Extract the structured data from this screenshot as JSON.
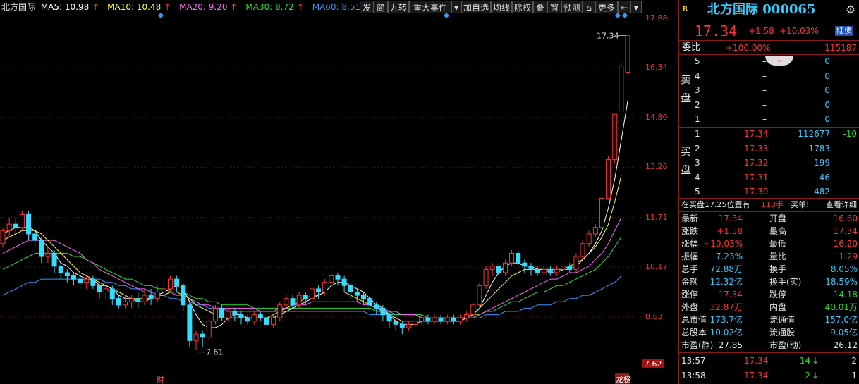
{
  "ma_legend": {
    "stock": "北方国际",
    "ma5": "MA5: 10.98",
    "ma10": "MA10: 10.48",
    "ma20": "MA20: 9.20",
    "ma30": "MA30: 8.72",
    "ma60": "MA60: 8.51",
    "up_arrow": "↑",
    "colors": {
      "ma5": "#ffffff",
      "ma10": "#ffff33",
      "ma20": "#ff66ff",
      "ma30": "#33dd33",
      "ma60": "#3399ff"
    }
  },
  "toolbar": [
    "发",
    "简",
    "九转",
    "重大事件",
    "加自选",
    "均线",
    "除权",
    "叠",
    "窗",
    "预测",
    "更多"
  ],
  "toolbar_icons": [
    "dropdown-icon",
    "lock-icon",
    "back-icon",
    "menu-arrow-icon"
  ],
  "y_axis": {
    "labels": [
      "17.88",
      "16.34",
      "14.80",
      "13.26",
      "11.71",
      "10.17",
      "8.63",
      "7.62"
    ],
    "values": [
      17.88,
      16.34,
      14.8,
      13.26,
      11.71,
      10.17,
      8.63,
      7.62
    ]
  },
  "annotations": {
    "high_label": "17.34",
    "low_label": "7.61",
    "event_cai": "财",
    "event_long": "龙榜"
  },
  "chart_data": {
    "type": "candlestick",
    "ymin": 7.1,
    "ymax": 18.0,
    "candles": [
      [
        10.9,
        11.3,
        10.8,
        11.4
      ],
      [
        11.3,
        11.5,
        11.1,
        11.7
      ],
      [
        11.5,
        11.4,
        11.2,
        11.7
      ],
      [
        11.4,
        11.8,
        11.3,
        11.9
      ],
      [
        11.8,
        11.2,
        11.0,
        11.9
      ],
      [
        11.2,
        11.0,
        10.8,
        11.4
      ],
      [
        11.0,
        10.5,
        10.3,
        11.1
      ],
      [
        10.5,
        10.6,
        10.3,
        10.8
      ],
      [
        10.6,
        10.2,
        10.0,
        10.7
      ],
      [
        10.2,
        10.0,
        9.8,
        10.3
      ],
      [
        10.0,
        9.9,
        9.7,
        10.1
      ],
      [
        9.9,
        9.8,
        9.6,
        10.0
      ],
      [
        9.8,
        9.7,
        9.5,
        9.9
      ],
      [
        9.7,
        9.8,
        9.5,
        9.9
      ],
      [
        9.8,
        9.6,
        9.5,
        9.9
      ],
      [
        9.6,
        9.4,
        9.2,
        9.7
      ],
      [
        9.4,
        9.5,
        9.2,
        9.6
      ],
      [
        9.5,
        9.2,
        9.0,
        9.6
      ],
      [
        9.2,
        9.0,
        8.9,
        9.3
      ],
      [
        9.0,
        9.1,
        8.9,
        9.3
      ],
      [
        9.1,
        9.2,
        8.9,
        9.3
      ],
      [
        9.2,
        9.1,
        8.9,
        9.4
      ],
      [
        9.1,
        9.3,
        9.0,
        9.5
      ],
      [
        9.3,
        9.2,
        9.0,
        9.5
      ],
      [
        9.2,
        9.4,
        9.1,
        9.6
      ],
      [
        9.4,
        9.5,
        9.2,
        9.7
      ],
      [
        9.5,
        9.8,
        9.4,
        9.9
      ],
      [
        9.8,
        9.6,
        9.4,
        9.9
      ],
      [
        9.6,
        9.0,
        8.8,
        9.7
      ],
      [
        9.0,
        7.9,
        7.7,
        9.1
      ],
      [
        7.9,
        8.1,
        7.6,
        8.2
      ],
      [
        8.1,
        8.0,
        7.7,
        8.2
      ],
      [
        8.0,
        8.5,
        7.9,
        8.6
      ],
      [
        8.5,
        8.9,
        8.4,
        9.0
      ],
      [
        8.9,
        8.6,
        8.5,
        9.0
      ],
      [
        8.6,
        8.8,
        8.5,
        8.9
      ],
      [
        8.8,
        8.7,
        8.5,
        8.9
      ],
      [
        8.7,
        8.6,
        8.4,
        8.8
      ],
      [
        8.6,
        8.5,
        8.4,
        8.7
      ],
      [
        8.5,
        8.7,
        8.4,
        8.8
      ],
      [
        8.7,
        8.6,
        8.5,
        8.8
      ],
      [
        8.6,
        8.4,
        8.3,
        8.7
      ],
      [
        8.4,
        8.6,
        8.3,
        8.7
      ],
      [
        8.6,
        9.0,
        8.5,
        9.1
      ],
      [
        9.0,
        9.2,
        8.9,
        9.3
      ],
      [
        9.2,
        9.0,
        8.9,
        9.3
      ],
      [
        9.0,
        9.3,
        8.9,
        9.4
      ],
      [
        9.3,
        9.2,
        9.0,
        9.4
      ],
      [
        9.2,
        9.5,
        9.1,
        9.6
      ],
      [
        9.5,
        9.4,
        9.2,
        9.6
      ],
      [
        9.4,
        9.7,
        9.3,
        9.8
      ],
      [
        9.7,
        9.9,
        9.6,
        10.0
      ],
      [
        9.9,
        9.8,
        9.6,
        10.0
      ],
      [
        9.8,
        9.6,
        9.4,
        9.9
      ],
      [
        9.6,
        9.4,
        9.2,
        9.7
      ],
      [
        9.4,
        9.3,
        9.1,
        9.5
      ],
      [
        9.3,
        9.2,
        9.0,
        9.4
      ],
      [
        9.2,
        9.0,
        8.9,
        9.3
      ],
      [
        9.0,
        8.9,
        8.7,
        9.1
      ],
      [
        8.9,
        8.7,
        8.5,
        9.0
      ],
      [
        8.7,
        8.5,
        8.3,
        8.8
      ],
      [
        8.5,
        8.4,
        8.2,
        8.6
      ],
      [
        8.4,
        8.3,
        8.1,
        8.5
      ],
      [
        8.3,
        8.4,
        8.2,
        8.5
      ],
      [
        8.4,
        8.5,
        8.3,
        8.6
      ],
      [
        8.5,
        8.6,
        8.4,
        8.7
      ],
      [
        8.6,
        8.5,
        8.4,
        8.7
      ],
      [
        8.5,
        8.6,
        8.4,
        8.7
      ],
      [
        8.6,
        8.5,
        8.4,
        8.7
      ],
      [
        8.5,
        8.6,
        8.4,
        8.7
      ],
      [
        8.6,
        8.5,
        8.4,
        8.7
      ],
      [
        8.5,
        8.6,
        8.4,
        8.7
      ],
      [
        8.6,
        8.7,
        8.5,
        8.8
      ],
      [
        8.7,
        9.0,
        8.6,
        9.1
      ],
      [
        9.0,
        9.6,
        8.9,
        9.7
      ],
      [
        9.6,
        10.1,
        9.5,
        10.2
      ],
      [
        10.1,
        10.2,
        9.9,
        10.3
      ],
      [
        10.2,
        10.0,
        9.9,
        10.3
      ],
      [
        10.0,
        10.3,
        9.9,
        10.4
      ],
      [
        10.3,
        10.6,
        10.2,
        10.7
      ],
      [
        10.6,
        10.3,
        10.2,
        10.7
      ],
      [
        10.3,
        10.2,
        10.0,
        10.4
      ],
      [
        10.2,
        10.1,
        9.9,
        10.3
      ],
      [
        10.1,
        10.0,
        9.9,
        10.2
      ],
      [
        10.0,
        10.1,
        9.9,
        10.2
      ],
      [
        10.1,
        10.0,
        9.9,
        10.2
      ],
      [
        10.0,
        10.1,
        9.9,
        10.2
      ],
      [
        10.1,
        10.2,
        10.0,
        10.3
      ],
      [
        10.2,
        10.1,
        10.0,
        10.3
      ],
      [
        10.1,
        10.5,
        10.0,
        10.6
      ],
      [
        10.5,
        10.9,
        10.4,
        11.0
      ],
      [
        10.9,
        11.2,
        10.8,
        11.3
      ],
      [
        11.2,
        11.4,
        11.1,
        11.5
      ],
      [
        11.4,
        12.3,
        11.3,
        12.4
      ],
      [
        12.3,
        13.5,
        12.9,
        13.6
      ],
      [
        13.5,
        14.9,
        13.4,
        14.9
      ],
      [
        15.0,
        16.4,
        15.0,
        16.5
      ],
      [
        16.2,
        17.34,
        16.2,
        17.34
      ]
    ],
    "ma5": [
      11.2,
      11.3,
      11.4,
      11.4,
      11.4,
      11.3,
      11.0,
      10.8,
      10.6,
      10.3,
      10.2,
      10.0,
      9.9,
      9.8,
      9.8,
      9.6,
      9.6,
      9.5,
      9.3,
      9.2,
      9.2,
      9.1,
      9.1,
      9.2,
      9.3,
      9.4,
      9.5,
      9.6,
      9.5,
      9.1,
      8.7,
      8.4,
      8.3,
      8.3,
      8.4,
      8.6,
      8.7,
      8.7,
      8.6,
      8.6,
      8.6,
      8.6,
      8.6,
      8.7,
      8.8,
      8.9,
      9.0,
      9.1,
      9.2,
      9.3,
      9.4,
      9.6,
      9.7,
      9.7,
      9.6,
      9.5,
      9.4,
      9.2,
      9.0,
      8.9,
      8.7,
      8.5,
      8.4,
      8.4,
      8.4,
      8.5,
      8.5,
      8.5,
      8.5,
      8.5,
      8.5,
      8.5,
      8.6,
      8.7,
      8.9,
      9.3,
      9.7,
      10.0,
      10.2,
      10.3,
      10.3,
      10.2,
      10.2,
      10.1,
      10.1,
      10.0,
      10.0,
      10.1,
      10.1,
      10.2,
      10.4,
      10.6,
      10.9,
      11.3,
      12.0,
      12.9,
      14.1,
      15.3
    ],
    "ma10": [
      11.0,
      11.1,
      11.2,
      11.3,
      11.3,
      11.3,
      11.2,
      11.0,
      10.8,
      10.6,
      10.4,
      10.2,
      10.0,
      9.9,
      9.8,
      9.7,
      9.6,
      9.5,
      9.4,
      9.3,
      9.2,
      9.2,
      9.2,
      9.2,
      9.3,
      9.3,
      9.4,
      9.4,
      9.3,
      9.2,
      9.0,
      8.9,
      8.8,
      8.7,
      8.6,
      8.6,
      8.6,
      8.6,
      8.6,
      8.6,
      8.6,
      8.6,
      8.7,
      8.8,
      8.9,
      9.0,
      9.1,
      9.2,
      9.3,
      9.3,
      9.4,
      9.4,
      9.4,
      9.4,
      9.3,
      9.2,
      9.1,
      9.0,
      8.9,
      8.8,
      8.7,
      8.6,
      8.5,
      8.5,
      8.5,
      8.5,
      8.5,
      8.5,
      8.5,
      8.5,
      8.5,
      8.5,
      8.6,
      8.7,
      8.9,
      9.1,
      9.3,
      9.5,
      9.7,
      9.9,
      10.0,
      10.1,
      10.1,
      10.1,
      10.1,
      10.1,
      10.1,
      10.1,
      10.2,
      10.3,
      10.4,
      10.6,
      10.8,
      11.1,
      11.5,
      12.2,
      13.0
    ],
    "ma20": [
      10.6,
      10.7,
      10.8,
      10.9,
      11.0,
      11.0,
      11.0,
      11.0,
      11.0,
      10.9,
      10.8,
      10.7,
      10.6,
      10.4,
      10.3,
      10.1,
      10.0,
      9.9,
      9.8,
      9.7,
      9.6,
      9.5,
      9.5,
      9.4,
      9.4,
      9.4,
      9.4,
      9.3,
      9.3,
      9.2,
      9.1,
      9.0,
      9.0,
      8.9,
      8.9,
      8.9,
      8.9,
      8.9,
      8.9,
      8.9,
      8.8,
      8.8,
      8.8,
      8.9,
      8.9,
      9.0,
      9.0,
      9.0,
      9.1,
      9.1,
      9.1,
      9.1,
      9.1,
      9.1,
      9.1,
      9.1,
      9.0,
      9.0,
      8.9,
      8.9,
      8.8,
      8.8,
      8.7,
      8.7,
      8.7,
      8.6,
      8.6,
      8.6,
      8.6,
      8.6,
      8.6,
      8.6,
      8.6,
      8.6,
      8.7,
      8.8,
      8.9,
      9.0,
      9.1,
      9.2,
      9.3,
      9.4,
      9.5,
      9.6,
      9.7,
      9.8,
      9.8,
      9.9,
      10.0,
      10.0,
      10.1,
      10.2,
      10.4,
      10.6,
      10.9,
      11.3,
      11.7
    ],
    "ma30": [
      10.1,
      10.2,
      10.3,
      10.4,
      10.5,
      10.6,
      10.6,
      10.6,
      10.6,
      10.6,
      10.6,
      10.5,
      10.5,
      10.4,
      10.3,
      10.2,
      10.1,
      10.0,
      9.9,
      9.8,
      9.8,
      9.7,
      9.6,
      9.6,
      9.5,
      9.5,
      9.4,
      9.4,
      9.4,
      9.3,
      9.2,
      9.2,
      9.1,
      9.1,
      9.0,
      9.0,
      9.0,
      9.0,
      9.0,
      8.9,
      8.9,
      8.9,
      8.9,
      8.9,
      8.9,
      8.9,
      8.9,
      8.9,
      8.9,
      8.9,
      8.9,
      8.9,
      8.9,
      8.9,
      8.9,
      8.9,
      8.9,
      8.9,
      8.8,
      8.8,
      8.8,
      8.7,
      8.7,
      8.7,
      8.7,
      8.7,
      8.6,
      8.6,
      8.6,
      8.6,
      8.6,
      8.6,
      8.6,
      8.7,
      8.7,
      8.8,
      8.8,
      8.9,
      9.0,
      9.1,
      9.1,
      9.2,
      9.3,
      9.4,
      9.4,
      9.5,
      9.6,
      9.6,
      9.7,
      9.8,
      9.9,
      10.0,
      10.1,
      10.3,
      10.5,
      10.8,
      11.1
    ],
    "ma60": [
      9.3,
      9.4,
      9.5,
      9.6,
      9.7,
      9.7,
      9.8,
      9.8,
      9.8,
      9.8,
      9.8,
      9.8,
      9.8,
      9.8,
      9.8,
      9.8,
      9.7,
      9.7,
      9.6,
      9.6,
      9.5,
      9.5,
      9.4,
      9.4,
      9.3,
      9.3,
      9.2,
      9.2,
      9.1,
      9.1,
      9.0,
      9.0,
      8.9,
      8.9,
      8.9,
      8.8,
      8.8,
      8.8,
      8.8,
      8.8,
      8.8,
      8.8,
      8.8,
      8.8,
      8.8,
      8.8,
      8.8,
      8.8,
      8.8,
      8.8,
      8.8,
      8.8,
      8.8,
      8.8,
      8.8,
      8.8,
      8.8,
      8.7,
      8.7,
      8.7,
      8.7,
      8.7,
      8.7,
      8.7,
      8.7,
      8.6,
      8.6,
      8.6,
      8.6,
      8.6,
      8.6,
      8.6,
      8.6,
      8.6,
      8.6,
      8.7,
      8.7,
      8.7,
      8.8,
      8.8,
      8.8,
      8.9,
      8.9,
      9.0,
      9.0,
      9.0,
      9.1,
      9.1,
      9.2,
      9.2,
      9.3,
      9.3,
      9.4,
      9.5,
      9.6,
      9.7,
      9.9
    ]
  },
  "panel": {
    "r_badge": "R",
    "stock_title": "北方国际 000065",
    "price": "17.34",
    "change": "+1.58",
    "change_pct": "+10.03%",
    "lugu_badge": "陆债",
    "weibi_label": "委比",
    "weibi_value": "+100.00%",
    "weibi_diff": "115187",
    "sell_label": "卖盘",
    "buy_label": "买盘",
    "sell": [
      {
        "level": "5",
        "price": "–",
        "vol": "0"
      },
      {
        "level": "4",
        "price": "–",
        "vol": "0"
      },
      {
        "level": "3",
        "price": "–",
        "vol": "0"
      },
      {
        "level": "2",
        "price": "–",
        "vol": "0"
      },
      {
        "level": "1",
        "price": "–",
        "vol": "0"
      }
    ],
    "buy": [
      {
        "level": "1",
        "price": "17.34",
        "vol": "112677",
        "extra": "-10"
      },
      {
        "level": "2",
        "price": "17.33",
        "vol": "1783",
        "extra": ""
      },
      {
        "level": "3",
        "price": "17.32",
        "vol": "199",
        "extra": ""
      },
      {
        "level": "4",
        "price": "17.31",
        "vol": "46",
        "extra": ""
      },
      {
        "level": "5",
        "price": "17.30",
        "vol": "482",
        "extra": ""
      }
    ],
    "notice": "在买盘17.25位置有",
    "notice_qty": "113手",
    "notice_type": "买单!",
    "notice_detail": "查看详细",
    "stats": [
      [
        "最新",
        "17.34",
        "开盘",
        "16.60"
      ],
      [
        "涨跌",
        "+1.58",
        "最高",
        "17.34"
      ],
      [
        "涨幅",
        "+10.03%",
        "最低",
        "16.20"
      ],
      [
        "振幅",
        "7.23%",
        "量比",
        "1.29"
      ],
      [
        "总手",
        "72.88万",
        "换手",
        "8.05%"
      ],
      [
        "金额",
        "12.32亿",
        "换手(实)",
        "18.59%"
      ],
      [
        "涨停",
        "17.34",
        "跌停",
        "14.18"
      ],
      [
        "外盘",
        "32.87万",
        "内盘",
        "40.01万"
      ],
      [
        "总市值",
        "173.7亿",
        "流通值",
        "157.0亿"
      ],
      [
        "总股本",
        "10.02亿",
        "流通股",
        "9.05亿"
      ],
      [
        "市盈(静)",
        "27.85",
        "市盈(动)",
        "26.12"
      ]
    ],
    "ticks": [
      {
        "time": "13:57",
        "price": "17.34",
        "vol": "14",
        "dir": "↓",
        "n": "2"
      },
      {
        "time": "13:58",
        "price": "17.34",
        "vol": "2",
        "dir": "↓",
        "n": "1"
      }
    ]
  }
}
